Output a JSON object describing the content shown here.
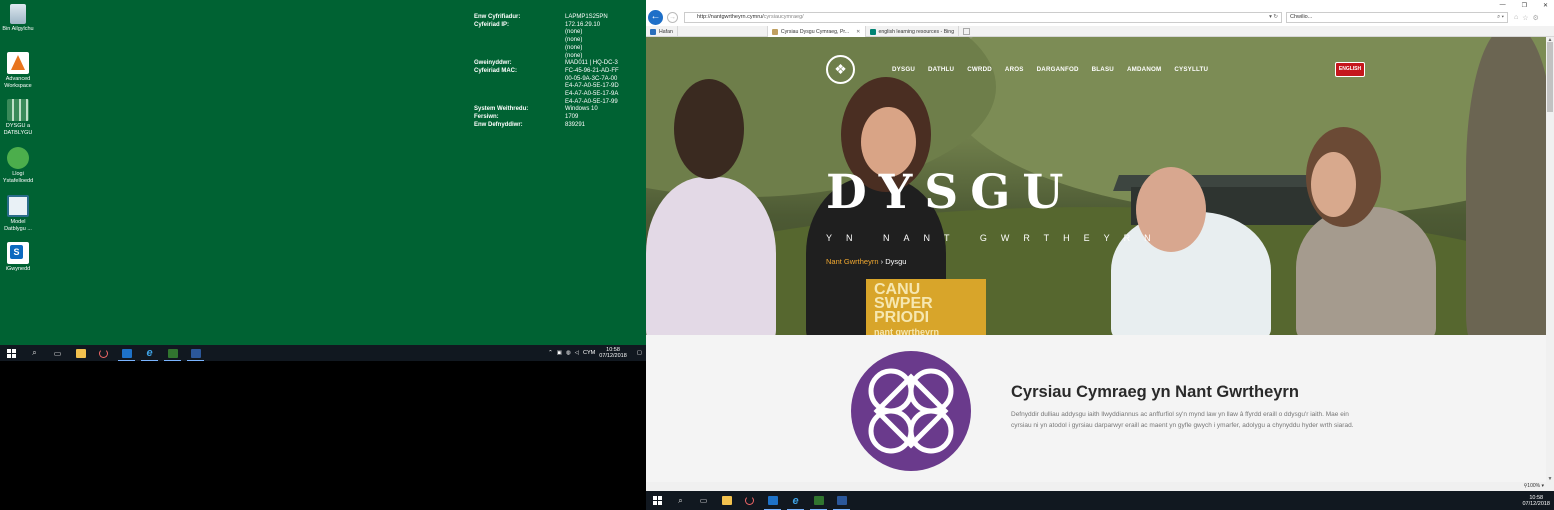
{
  "desktop": {
    "icons": [
      {
        "label": "Bin Ailgylchu",
        "icon": "recycle-bin-icon"
      },
      {
        "label": "Advanced Workspace",
        "icon": "workspace-icon"
      },
      {
        "label": "DYSGU a DATBLYGU",
        "icon": "spreadsheet-icon"
      },
      {
        "label": "Llogi Ystafelloedd",
        "icon": "booking-icon"
      },
      {
        "label": "Model Datblygu ...",
        "icon": "monitor-icon"
      },
      {
        "label": "iGwynedd",
        "icon": "sharepoint-icon"
      }
    ],
    "bginfo": [
      {
        "key": "Enw Cyfrifiadur:",
        "values": [
          "LAPMP1S25PN"
        ]
      },
      {
        "key": "Cyfeiriad IP:",
        "values": [
          "172.16.29.10",
          "(none)",
          "(none)",
          "(none)",
          "(none)"
        ]
      },
      {
        "key": "Gweinyddwr:",
        "values": [
          "MAD011 | HQ-DC-3"
        ]
      },
      {
        "key": "Cyfeiriad MAC:",
        "values": [
          "FC-45-96-21-AD-FF",
          "00-05-9A-3C-7A-00",
          "E4-A7-A0-5E-17-9D",
          "E4-A7-A0-5E-17-9A",
          "E4-A7-A0-5E-17-99"
        ]
      },
      {
        "key": "System Weithredu:",
        "values": [
          "Windows 10"
        ]
      },
      {
        "key": "Fersiwn:",
        "values": [
          "1709"
        ]
      },
      {
        "key": "Enw Defnyddiwr:",
        "values": [
          "839291"
        ]
      }
    ]
  },
  "taskbar_left": {
    "language": "CYM",
    "time": "10:58",
    "date": "07/12/2018"
  },
  "taskbar_right": {
    "time": "10:58",
    "date": "07/12/2018"
  },
  "browser": {
    "url_prefix": "http://nantgwrtheyrn.cymru/",
    "url_path": "cyrsiaucymraeg/",
    "search_placeholder": "Chwilio...",
    "tabs": [
      {
        "label": "Hafan"
      },
      {
        "label": "Cyrsiau Dysgu Cymraeg, Pr..."
      },
      {
        "label": "english learning resources - Bing"
      }
    ],
    "zoom": "100%"
  },
  "site": {
    "logo_glyph": "❖",
    "nav": [
      "DYSGU",
      "DATHLU",
      "CWRDD",
      "AROS",
      "DARGANFOD",
      "BLASU",
      "AMDANOM",
      "CYSYLLTU"
    ],
    "english_button": "ENGLISH",
    "hero_title": "DYSGU",
    "hero_subtitle": "YN NANT GWRTHEYRN",
    "breadcrumb_link": "Nant Gwrtheyrn",
    "breadcrumb_sep": "›",
    "breadcrumb_current": "Dysgu",
    "book_lines": [
      "CANU",
      "SWPER",
      "PRIODI",
      "nant gwrtheyrn"
    ],
    "section_title": "Cyrsiau Cymraeg yn Nant Gwrtheyrn",
    "section_body": "Defnyddir dulliau addysgu iaith llwyddiannus ac anffurfiol sy'n mynd law yn llaw â ffyrdd eraill o ddysgu'r iaith. Mae ein cyrsiau ni yn atodol i gyrsiau darparwyr eraill ac maent yn gyfle gwych i ymarfer, adolygu a chynyddu hyder wrth siarad."
  },
  "colors": {
    "desktop_green": "#006233",
    "accent_red": "#c5161d",
    "knot_purple": "#6a3a8c",
    "breadcrumb_orange": "#f0a830"
  }
}
